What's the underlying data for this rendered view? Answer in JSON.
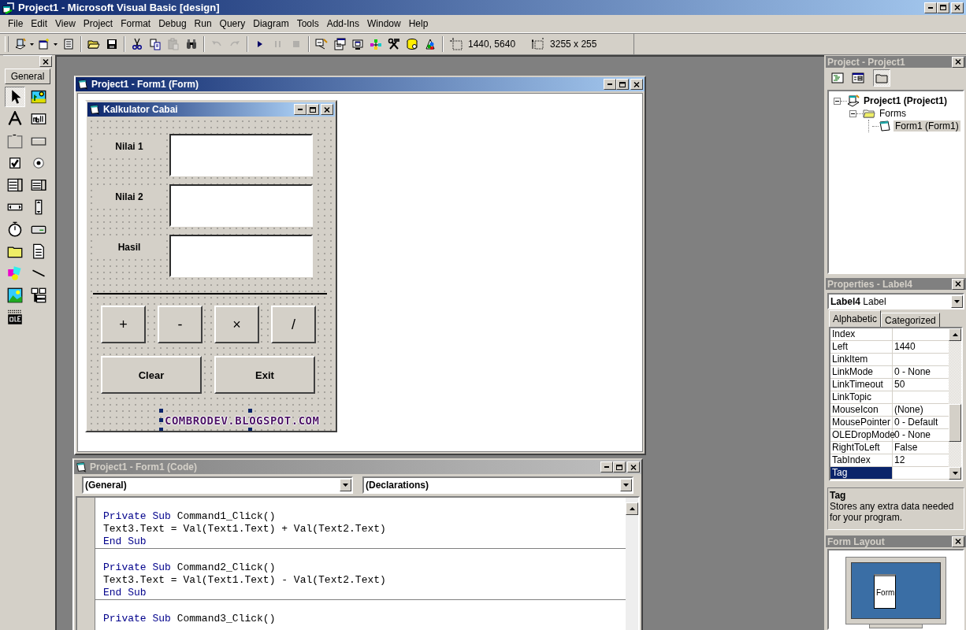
{
  "app_window": {
    "title": "Project1 - Microsoft Visual Basic [design]"
  },
  "menu": [
    "File",
    "Edit",
    "View",
    "Project",
    "Format",
    "Debug",
    "Run",
    "Query",
    "Diagram",
    "Tools",
    "Add-Ins",
    "Window",
    "Help"
  ],
  "toolbar": {
    "buttons": [
      {
        "kind": "add-project",
        "disabled": false
      },
      {
        "kind": "add-form",
        "disabled": false
      },
      {
        "kind": "menu-editor",
        "disabled": false
      },
      {
        "kind": "open",
        "disabled": false
      },
      {
        "kind": "save",
        "disabled": false
      },
      {
        "kind": "cut",
        "disabled": false
      },
      {
        "kind": "copy",
        "disabled": false
      },
      {
        "kind": "paste",
        "disabled": true
      },
      {
        "kind": "find",
        "disabled": false
      },
      {
        "kind": "undo",
        "disabled": true
      },
      {
        "kind": "redo",
        "disabled": true
      },
      {
        "kind": "start",
        "disabled": false
      },
      {
        "kind": "break",
        "disabled": true
      },
      {
        "kind": "end",
        "disabled": true
      },
      {
        "kind": "project-explorer",
        "disabled": false
      },
      {
        "kind": "properties",
        "disabled": false
      },
      {
        "kind": "form-layout",
        "disabled": false
      },
      {
        "kind": "object-browser",
        "disabled": false
      },
      {
        "kind": "toolbox",
        "disabled": false
      },
      {
        "kind": "data-view",
        "disabled": false
      },
      {
        "kind": "component",
        "disabled": false
      }
    ],
    "position": "1440, 5640",
    "size": "3255 x 255"
  },
  "toolbox": {
    "tab": "General",
    "tools": [
      {
        "kind": "pointer",
        "selected": true
      },
      {
        "kind": "picture",
        "selected": false
      },
      {
        "kind": "label",
        "selected": false
      },
      {
        "kind": "textbox",
        "selected": false
      },
      {
        "kind": "frame",
        "selected": false
      },
      {
        "kind": "command",
        "selected": false
      },
      {
        "kind": "checkbox",
        "selected": false
      },
      {
        "kind": "option",
        "selected": false
      },
      {
        "kind": "combo",
        "selected": false
      },
      {
        "kind": "list",
        "selected": false
      },
      {
        "kind": "hscroll",
        "selected": false
      },
      {
        "kind": "vscroll",
        "selected": false
      },
      {
        "kind": "timer",
        "selected": false
      },
      {
        "kind": "drive",
        "selected": false
      },
      {
        "kind": "dir",
        "selected": false
      },
      {
        "kind": "file",
        "selected": false
      },
      {
        "kind": "shape",
        "selected": false
      },
      {
        "kind": "line",
        "selected": false
      },
      {
        "kind": "image",
        "selected": false
      },
      {
        "kind": "data",
        "selected": false
      },
      {
        "kind": "ole",
        "selected": false
      }
    ]
  },
  "form_window": {
    "title": "Project1 - Form1 (Form)",
    "active": true,
    "form": {
      "title": "Kalkulator Cabai",
      "fields": [
        {
          "label": "Nilai 1"
        },
        {
          "label": "Nilai 2"
        },
        {
          "label": "Hasil"
        }
      ],
      "operators": [
        "+",
        "-",
        "×",
        "/"
      ],
      "actions": [
        "Clear",
        "Exit"
      ],
      "footer_label": {
        "text": "COMBRODEV.BLOGSPOT.COM",
        "selected": true
      }
    }
  },
  "code_window": {
    "title": "Project1 - Form1 (Code)",
    "active": false,
    "object": "(General)",
    "procedure": "(Declarations)",
    "procedures": [
      {
        "lines": [
          [
            {
              "kind": "keyword",
              "text": "Private Sub"
            },
            {
              "kind": "plain",
              "text": " Command1_Click()"
            }
          ],
          [
            {
              "kind": "plain",
              "text": "Text3.Text = Val(Text1.Text) + Val(Text2.Text)"
            }
          ],
          [
            {
              "kind": "keyword",
              "text": "End Sub"
            }
          ]
        ]
      },
      {
        "lines": [
          [
            {
              "kind": "keyword",
              "text": "Private Sub"
            },
            {
              "kind": "plain",
              "text": " Command2_Click()"
            }
          ],
          [
            {
              "kind": "plain",
              "text": "Text3.Text = Val(Text1.Text) - Val(Text2.Text)"
            }
          ],
          [
            {
              "kind": "keyword",
              "text": "End Sub"
            }
          ]
        ]
      },
      {
        "lines": [
          [
            {
              "kind": "keyword",
              "text": "Private Sub"
            },
            {
              "kind": "plain",
              "text": " Command3_Click()"
            }
          ]
        ]
      }
    ]
  },
  "project_panel": {
    "title": "Project - Project1",
    "tree": [
      {
        "kind": "project",
        "label": "Project1 (Project1)",
        "expanded": true,
        "selected": false,
        "children": [
          {
            "kind": "folder",
            "label": "Forms",
            "expanded": true,
            "selected": false,
            "children": [
              {
                "kind": "form",
                "label": "Form1 (Form1)",
                "selected": true
              }
            ]
          }
        ]
      }
    ]
  },
  "properties_panel": {
    "title": "Properties - Label4",
    "object_name": "Label4",
    "object_type": "Label",
    "tabs": [
      {
        "label": "Alphabetic",
        "selected": true
      },
      {
        "label": "Categorized",
        "selected": false
      }
    ],
    "rows": [
      {
        "name": "Index",
        "selected": false
      },
      {
        "name": "Left",
        "value": "1440",
        "selected": false
      },
      {
        "name": "LinkItem",
        "selected": false
      },
      {
        "name": "LinkMode",
        "value": "0 - None",
        "selected": false
      },
      {
        "name": "LinkTimeout",
        "value": "50",
        "selected": false
      },
      {
        "name": "LinkTopic",
        "selected": false
      },
      {
        "name": "MouseIcon",
        "value": "(None)",
        "selected": false
      },
      {
        "name": "MousePointer",
        "value": "0 - Default",
        "selected": false
      },
      {
        "name": "OLEDropMode",
        "value": "0 - None",
        "selected": false
      },
      {
        "name": "RightToLeft",
        "value": "False",
        "selected": false
      },
      {
        "name": "TabIndex",
        "value": "12",
        "selected": false
      },
      {
        "name": "Tag",
        "selected": true
      }
    ],
    "description": {
      "title": "Tag",
      "text": "Stores any extra data needed for your program."
    }
  },
  "form_layout": {
    "title": "Form Layout",
    "form_label": "Form"
  }
}
